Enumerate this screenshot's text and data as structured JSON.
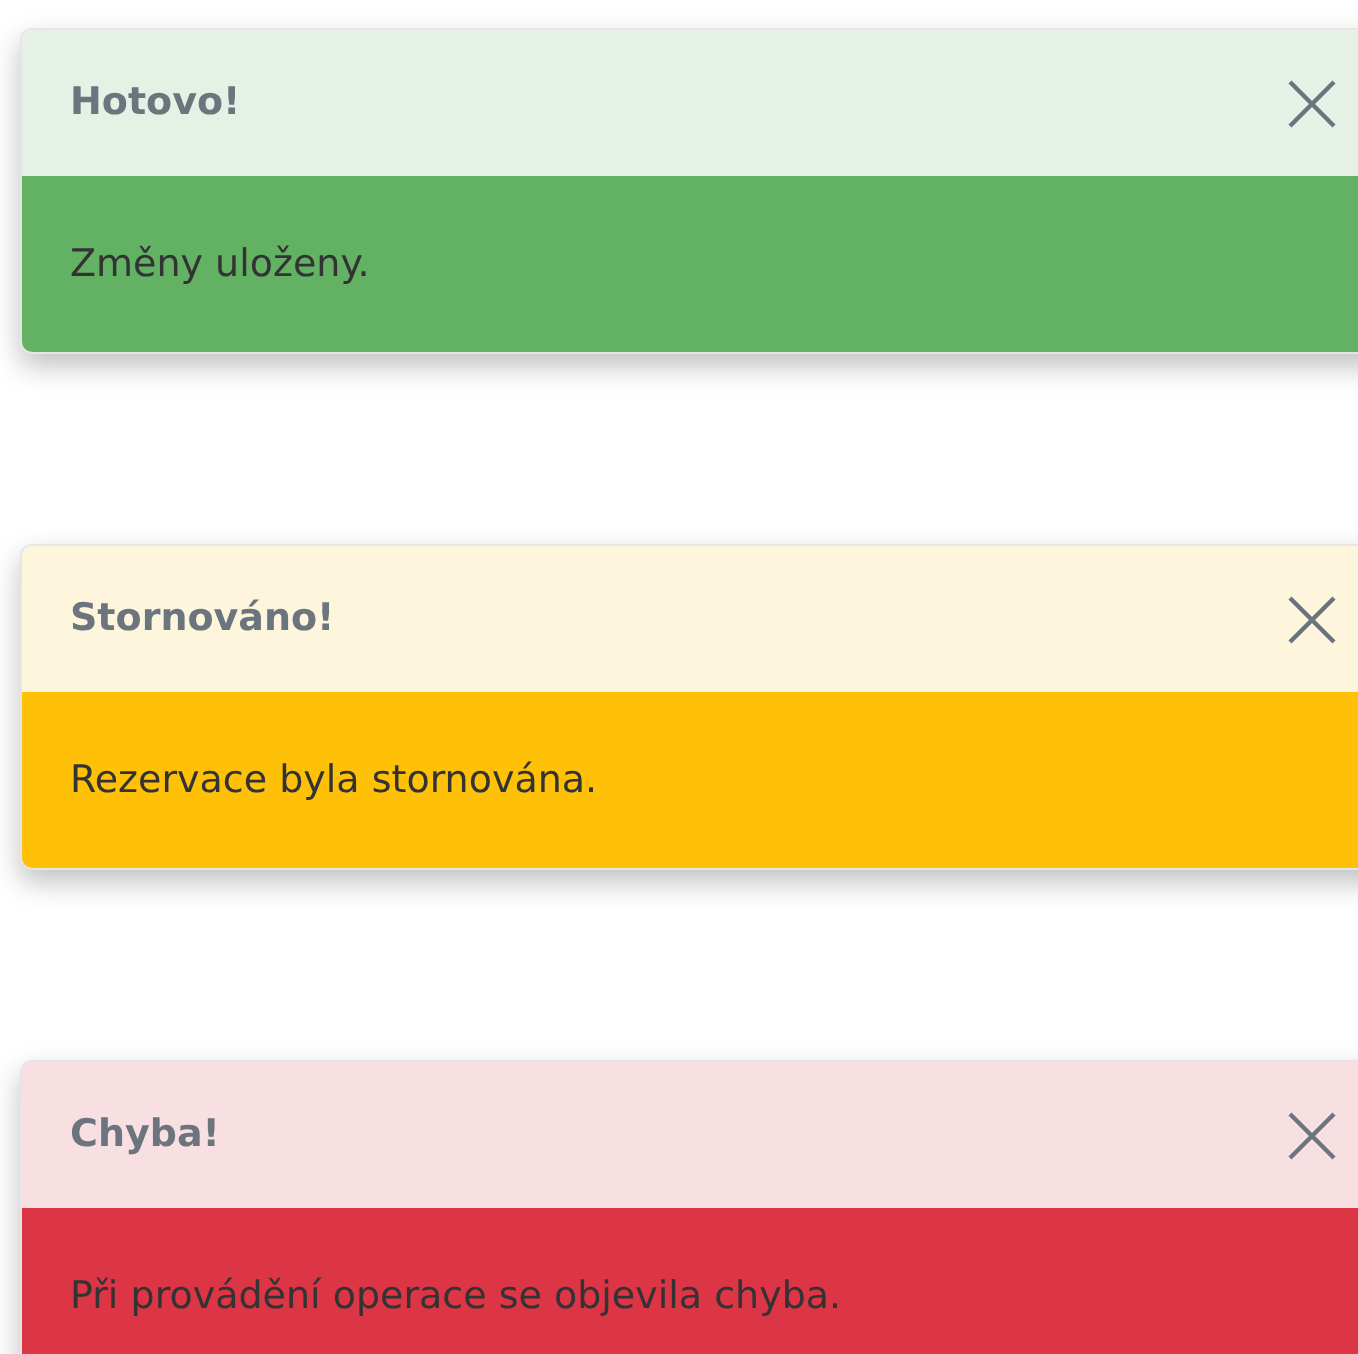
{
  "toasts": [
    {
      "kind": "success",
      "title": "Hotovo!",
      "message": "Změny uloženy."
    },
    {
      "kind": "warning",
      "title": "Stornováno!",
      "message": "Rezervace byla stornována."
    },
    {
      "kind": "danger",
      "title": "Chyba!",
      "message": "Při provádění operace se objevila chyba."
    }
  ]
}
